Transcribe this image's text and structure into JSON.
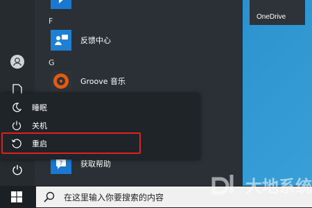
{
  "desktop": {
    "onedrive_tile": "OneDrive"
  },
  "start_menu": {
    "letters": [
      "F",
      "G"
    ],
    "apps": [
      {
        "name": "反馈中心",
        "icon": "feedback-hub-icon"
      },
      {
        "name": "Groove 音乐",
        "icon": "groove-music-icon"
      },
      {
        "name": "获取帮助",
        "icon": "get-help-icon"
      }
    ],
    "power_menu": {
      "items": [
        {
          "label": "睡眠",
          "icon": "sleep-moon-icon"
        },
        {
          "label": "关机",
          "icon": "shutdown-icon"
        },
        {
          "label": "重启",
          "icon": "restart-icon"
        }
      ]
    },
    "highlight_color": "#e21e1e"
  },
  "taskbar": {
    "search_placeholder": "在这里输入你要搜索的内容"
  },
  "watermark": {
    "text": "大地系统"
  }
}
